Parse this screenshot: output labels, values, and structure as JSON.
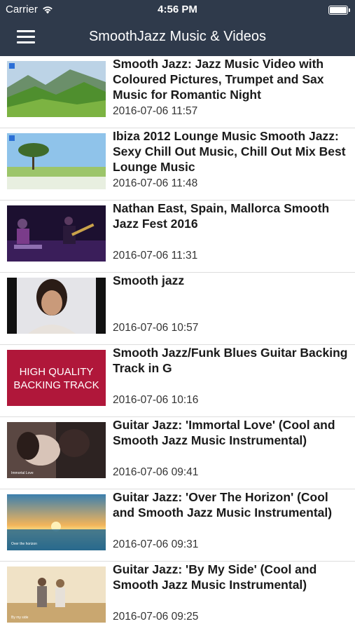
{
  "status_bar": {
    "carrier": "Carrier",
    "time": "4:56 PM"
  },
  "navbar": {
    "title": "SmoothJazz Music & Videos",
    "menu_icon": "hamburger-menu-icon"
  },
  "videos": [
    {
      "title": "Smooth Jazz: Jazz Music Video with Coloured Pictures, Trumpet and Sax Music for Romantic Night",
      "date": "2016-07-06 11:57",
      "thumb": "green-mountain-valley"
    },
    {
      "title": "Ibiza 2012 Lounge Music Smooth Jazz: Sexy Chill Out Music, Chill Out Mix Best Lounge Music",
      "date": "2016-07-06 11:48",
      "thumb": "tree-in-flower-field"
    },
    {
      "title": "Nathan East, Spain, Mallorca Smooth Jazz Fest 2016",
      "date": "2016-07-06 11:31",
      "thumb": "band-on-stage"
    },
    {
      "title": "Smooth jazz",
      "date": "2016-07-06 10:57",
      "thumb": "man-portrait"
    },
    {
      "title": "Smooth Jazz/Funk Blues Guitar Backing Track in G",
      "date": "2016-07-06 10:16",
      "thumb": "backing-track-card",
      "thumb_text": [
        "HIGH QUALITY",
        "BACKING TRACK"
      ]
    },
    {
      "title": "Guitar Jazz: 'Immortal Love' (Cool and Smooth Jazz Music Instrumental)",
      "date": "2016-07-06 09:41",
      "thumb": "couple-embrace",
      "thumb_caption": "Immortal Love"
    },
    {
      "title": "Guitar Jazz: 'Over The Horizon' (Cool and Smooth Jazz Music Instrumental)",
      "date": "2016-07-06 09:31",
      "thumb": "sunset-horizon",
      "thumb_caption": "Over the horizon"
    },
    {
      "title": "Guitar Jazz: 'By My Side' (Cool and Smooth Jazz Music Instrumental)",
      "date": "2016-07-06 09:25",
      "thumb": "couple-walking",
      "thumb_caption": "By my side"
    }
  ],
  "colors": {
    "navbar": "#2f3a4b",
    "backing_track_red": "#b0173a",
    "title_text": "#1a1a1a"
  }
}
